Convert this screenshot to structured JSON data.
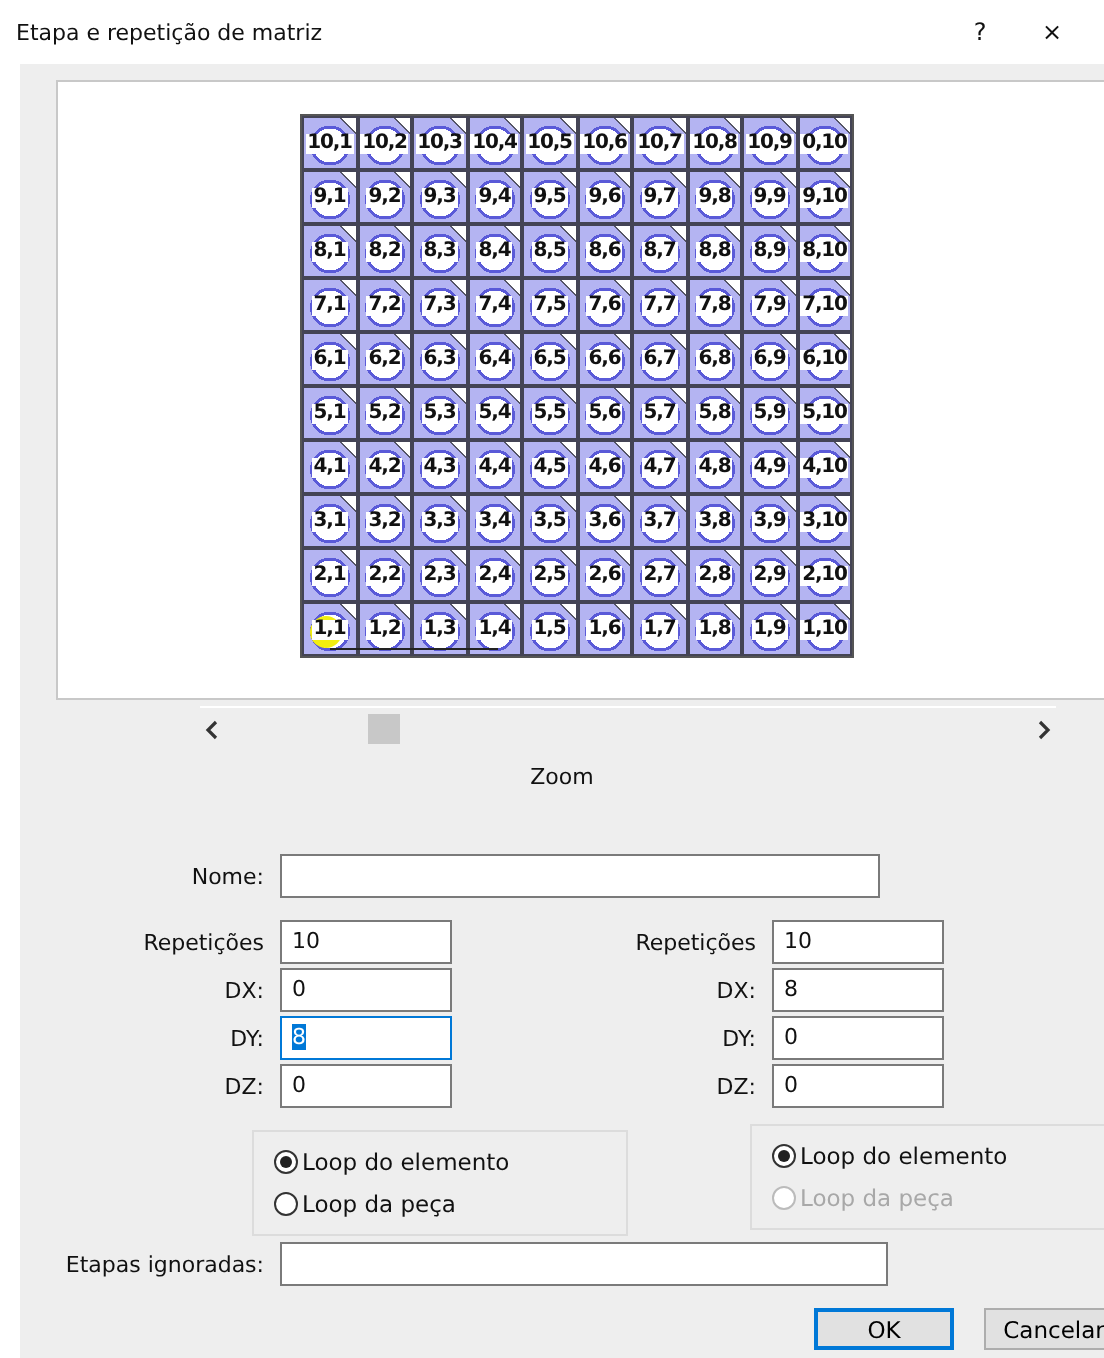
{
  "window": {
    "title": "Etapa e repetição de matriz",
    "help": "?",
    "close": "×"
  },
  "matrix": {
    "rows": [
      [
        {
          "label": "10,1",
          "selected": false
        },
        {
          "label": "10,2",
          "selected": false
        },
        {
          "label": "10,3",
          "selected": false
        },
        {
          "label": "10,4",
          "selected": false
        },
        {
          "label": "10,5",
          "selected": false
        },
        {
          "label": "10,6",
          "selected": false
        },
        {
          "label": "10,7",
          "selected": false
        },
        {
          "label": "10,8",
          "selected": false
        },
        {
          "label": "10,9",
          "selected": false
        },
        {
          "label": "0,10",
          "selected": false
        }
      ],
      [
        {
          "label": "9,1",
          "selected": false
        },
        {
          "label": "9,2",
          "selected": false
        },
        {
          "label": "9,3",
          "selected": false
        },
        {
          "label": "9,4",
          "selected": false
        },
        {
          "label": "9,5",
          "selected": false
        },
        {
          "label": "9,6",
          "selected": false
        },
        {
          "label": "9,7",
          "selected": false
        },
        {
          "label": "9,8",
          "selected": false
        },
        {
          "label": "9,9",
          "selected": false
        },
        {
          "label": "9,10",
          "selected": false
        }
      ],
      [
        {
          "label": "8,1",
          "selected": false
        },
        {
          "label": "8,2",
          "selected": false
        },
        {
          "label": "8,3",
          "selected": false
        },
        {
          "label": "8,4",
          "selected": false
        },
        {
          "label": "8,5",
          "selected": false
        },
        {
          "label": "8,6",
          "selected": false
        },
        {
          "label": "8,7",
          "selected": false
        },
        {
          "label": "8,8",
          "selected": false
        },
        {
          "label": "8,9",
          "selected": false
        },
        {
          "label": "8,10",
          "selected": false
        }
      ],
      [
        {
          "label": "7,1",
          "selected": false
        },
        {
          "label": "7,2",
          "selected": false
        },
        {
          "label": "7,3",
          "selected": false
        },
        {
          "label": "7,4",
          "selected": false
        },
        {
          "label": "7,5",
          "selected": false
        },
        {
          "label": "7,6",
          "selected": false
        },
        {
          "label": "7,7",
          "selected": false
        },
        {
          "label": "7,8",
          "selected": false
        },
        {
          "label": "7,9",
          "selected": false
        },
        {
          "label": "7,10",
          "selected": false
        }
      ],
      [
        {
          "label": "6,1",
          "selected": false
        },
        {
          "label": "6,2",
          "selected": false
        },
        {
          "label": "6,3",
          "selected": false
        },
        {
          "label": "6,4",
          "selected": false
        },
        {
          "label": "6,5",
          "selected": false
        },
        {
          "label": "6,6",
          "selected": false
        },
        {
          "label": "6,7",
          "selected": false
        },
        {
          "label": "6,8",
          "selected": false
        },
        {
          "label": "6,9",
          "selected": false
        },
        {
          "label": "6,10",
          "selected": false
        }
      ],
      [
        {
          "label": "5,1",
          "selected": false
        },
        {
          "label": "5,2",
          "selected": false
        },
        {
          "label": "5,3",
          "selected": false
        },
        {
          "label": "5,4",
          "selected": false
        },
        {
          "label": "5,5",
          "selected": false
        },
        {
          "label": "5,6",
          "selected": false
        },
        {
          "label": "5,7",
          "selected": false
        },
        {
          "label": "5,8",
          "selected": false
        },
        {
          "label": "5,9",
          "selected": false
        },
        {
          "label": "5,10",
          "selected": false
        }
      ],
      [
        {
          "label": "4,1",
          "selected": false
        },
        {
          "label": "4,2",
          "selected": false
        },
        {
          "label": "4,3",
          "selected": false
        },
        {
          "label": "4,4",
          "selected": false
        },
        {
          "label": "4,5",
          "selected": false
        },
        {
          "label": "4,6",
          "selected": false
        },
        {
          "label": "4,7",
          "selected": false
        },
        {
          "label": "4,8",
          "selected": false
        },
        {
          "label": "4,9",
          "selected": false
        },
        {
          "label": "4,10",
          "selected": false
        }
      ],
      [
        {
          "label": "3,1",
          "selected": false
        },
        {
          "label": "3,2",
          "selected": false
        },
        {
          "label": "3,3",
          "selected": false
        },
        {
          "label": "3,4",
          "selected": false
        },
        {
          "label": "3,5",
          "selected": false
        },
        {
          "label": "3,6",
          "selected": false
        },
        {
          "label": "3,7",
          "selected": false
        },
        {
          "label": "3,8",
          "selected": false
        },
        {
          "label": "3,9",
          "selected": false
        },
        {
          "label": "3,10",
          "selected": false
        }
      ],
      [
        {
          "label": "2,1",
          "selected": false
        },
        {
          "label": "2,2",
          "selected": false
        },
        {
          "label": "2,3",
          "selected": false
        },
        {
          "label": "2,4",
          "selected": false
        },
        {
          "label": "2,5",
          "selected": false
        },
        {
          "label": "2,6",
          "selected": false
        },
        {
          "label": "2,7",
          "selected": false
        },
        {
          "label": "2,8",
          "selected": false
        },
        {
          "label": "2,9",
          "selected": false
        },
        {
          "label": "2,10",
          "selected": false
        }
      ],
      [
        {
          "label": "1,1",
          "selected": true
        },
        {
          "label": "1,2",
          "selected": false
        },
        {
          "label": "1,3",
          "selected": false
        },
        {
          "label": "1,4",
          "selected": false
        },
        {
          "label": "1,5",
          "selected": false
        },
        {
          "label": "1,6",
          "selected": false
        },
        {
          "label": "1,7",
          "selected": false
        },
        {
          "label": "1,8",
          "selected": false
        },
        {
          "label": "1,9",
          "selected": false
        },
        {
          "label": "1,10",
          "selected": false
        }
      ]
    ]
  },
  "zoom_label": "Zoom",
  "name_field": {
    "label": "Nome:"
  },
  "groups": [
    {
      "fields": [
        {
          "label": "Repetições",
          "value": "10",
          "focused": false
        },
        {
          "label": "DX:",
          "value": "0",
          "focused": false
        },
        {
          "label": "DY:",
          "value": "8",
          "focused": true
        },
        {
          "label": "DZ:",
          "value": "0",
          "focused": false
        }
      ],
      "radios": [
        {
          "label": "Loop do elemento",
          "selected": true,
          "disabled": false
        },
        {
          "label": "Loop da peça",
          "selected": false,
          "disabled": false
        }
      ]
    },
    {
      "fields": [
        {
          "label": "Repetições",
          "value": "10",
          "focused": false
        },
        {
          "label": "DX:",
          "value": "8",
          "focused": false
        },
        {
          "label": "DY:",
          "value": "0",
          "focused": false
        },
        {
          "label": "DZ:",
          "value": "0",
          "focused": false
        }
      ],
      "radios": [
        {
          "label": "Loop do elemento",
          "selected": true,
          "disabled": false
        },
        {
          "label": "Loop da peça",
          "selected": false,
          "disabled": true
        }
      ]
    }
  ],
  "skipped_field": {
    "label": "Etapas ignoradas:"
  },
  "buttons": [
    {
      "label": "OK",
      "default": true
    },
    {
      "label": "Cancelar",
      "default": false
    }
  ]
}
